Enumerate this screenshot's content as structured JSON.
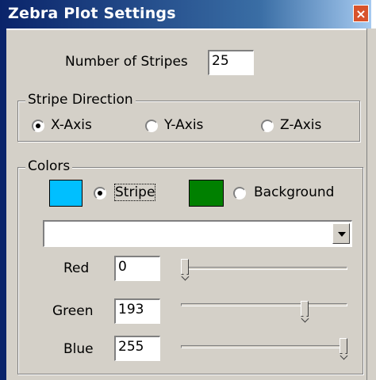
{
  "window": {
    "title": "Zebra Plot Settings",
    "close_label": "×"
  },
  "stripes": {
    "label": "Number of Stripes",
    "value": "25"
  },
  "direction": {
    "group_label": "Stripe Direction",
    "options": [
      {
        "label": "X-Axis",
        "selected": true
      },
      {
        "label": "Y-Axis",
        "selected": false
      },
      {
        "label": "Z-Axis",
        "selected": false
      }
    ]
  },
  "colors": {
    "group_label": "Colors",
    "stripe": {
      "label": "Stripe",
      "selected": true,
      "color": "#00bfff"
    },
    "background": {
      "label": "Background",
      "selected": false,
      "color": "#008000"
    },
    "dropdown_value": "",
    "channels": [
      {
        "label": "Red",
        "value": "0",
        "fraction": 0.0
      },
      {
        "label": "Green",
        "value": "193",
        "fraction": 0.757
      },
      {
        "label": "Blue",
        "value": "255",
        "fraction": 1.0
      }
    ]
  }
}
